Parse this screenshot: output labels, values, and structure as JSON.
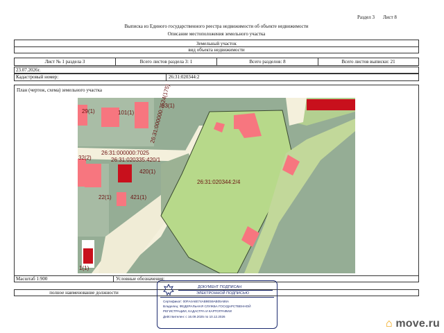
{
  "header": {
    "section": "Раздел 3",
    "sheet": "Лист 8",
    "title": "Выписка из Единого государственного реестра недвижимости об объекте недвижимости",
    "subtitle": "Описание местоположения земельного участка"
  },
  "object": {
    "name": "Земельный участок",
    "type_caption": "вид объекта недвижимости"
  },
  "sheet_info": {
    "sheet_no": "Лист № 1 раздела 3",
    "total_sheets_section": "Всего листов раздела 3: 1",
    "total_sections": "Всего разделов: 8",
    "total_sheets_extract": "Всего листов выписки: 21"
  },
  "date": "23.07.2026г.",
  "cadastral": {
    "label": "Кадастровый номер:",
    "value": "26:31:020344:2"
  },
  "plan_title": "План (чертеж, схема) земельного участка",
  "map": {
    "labels": {
      "l29": "29(1)",
      "l101": "101(1)",
      "l63": "63(1)",
      "lroad": "26:31:000000:7025",
      "lvert": "26:31:000000:7524(175)",
      "l420a": "26:31:020335:420/1",
      "l32": "32(2)",
      "l420": "420(1)",
      "lmain": "26:31:020344:2/4",
      "l22": "22(1)",
      "l421": "421(1)",
      "l1": "1(1)"
    },
    "colors": {
      "parcel": "#b7d98a",
      "background": "#95ad95",
      "building": "#f7767f",
      "building_dark": "#c8101c",
      "road": "#f4f0dc"
    }
  },
  "footer": {
    "scale": "Масштаб 1:900",
    "legend": "Условные обозначения:",
    "position": "полное наименование должности"
  },
  "stamp": {
    "title": "ДОКУМЕНТ ПОДПИСАН",
    "subtitle": "ЭЛЕКТРОННОЙ ПОДПИСЬЮ",
    "cert": "Сертификат: 00FA4A6E74AB9E59AB05A86A",
    "owner1": "Владелец: ФЕДЕРАЛЬНАЯ СЛУЖБА ГОСУДАРСТВЕННОЙ",
    "owner2": "РЕГИСТРАЦИИ, КАДАСТРА И КАРТОГРАФИИ",
    "valid": "Действителен: с 16.09.2025 по 10.12.2026"
  },
  "watermark": "move.ru"
}
